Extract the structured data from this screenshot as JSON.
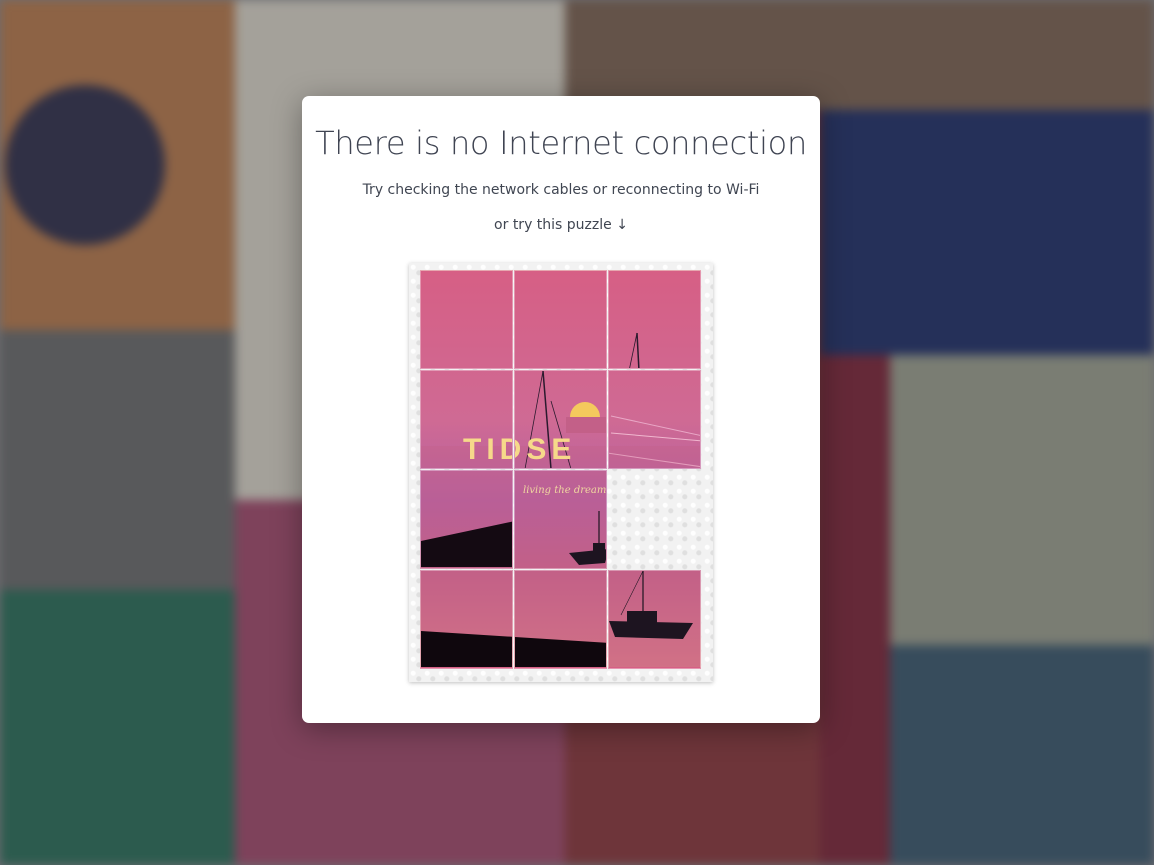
{
  "dialog": {
    "title": "There is no Internet connection",
    "subtitle": "Try checking the network cables or reconnecting to Wi-Fi",
    "hint": "or try this puzzle ↓"
  },
  "puzzle": {
    "image_text": {
      "title": "TIDSE",
      "tagline": "living the dream"
    },
    "tiles": [
      {
        "name": "tile-1",
        "src_col": 0,
        "src_row": 0
      },
      {
        "name": "tile-2",
        "src_col": 1,
        "src_row": 0
      },
      {
        "name": "tile-3",
        "src_col": 2,
        "src_row": 0
      },
      {
        "name": "tile-4",
        "src_col": 0,
        "src_row": 1
      },
      {
        "name": "tile-5",
        "src_col": 1,
        "src_row": 1
      },
      {
        "name": "tile-6",
        "src_col": 2,
        "src_row": 1
      },
      {
        "name": "tile-7",
        "src_col": 0,
        "src_row": 2
      },
      {
        "name": "tile-8",
        "src_col": 1,
        "src_row": 2
      },
      {
        "name": "tile-10",
        "src_col": 0,
        "src_row": 3
      },
      {
        "name": "tile-11",
        "src_col": 1,
        "src_row": 3
      },
      {
        "name": "tile-12",
        "src_col": 2,
        "src_row": 3
      }
    ],
    "empty_slot": {
      "col": 2,
      "row": 2
    }
  },
  "colors": {
    "modal_bg": "#ffffff",
    "title_text": "#3f4452",
    "body_text": "#404652",
    "puzzle_sky": "#d65f85",
    "puzzle_sea": "#c36088",
    "sun": "#f4c95d",
    "title_yellow": "#f6d98a"
  }
}
